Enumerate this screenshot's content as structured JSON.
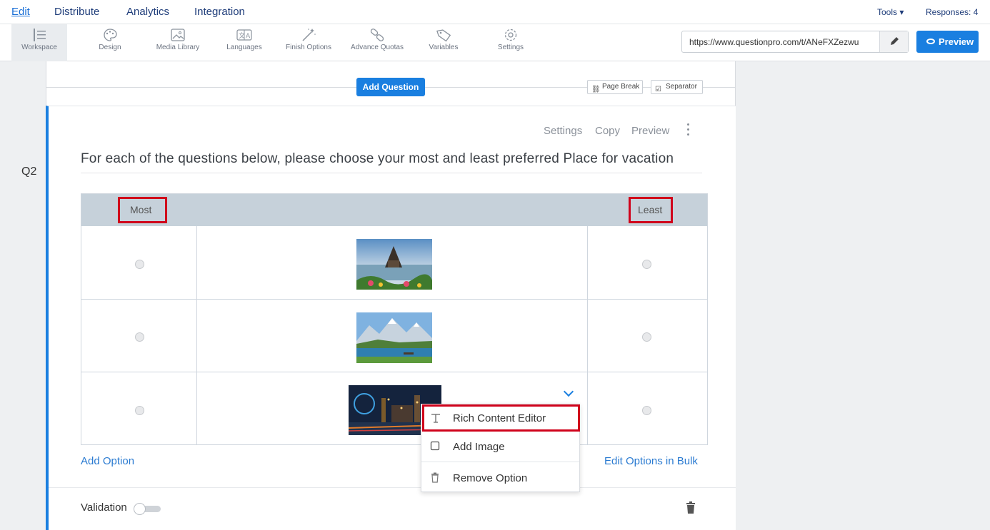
{
  "nav": {
    "items": [
      "Edit",
      "Distribute",
      "Analytics",
      "Integration"
    ],
    "tools": "Tools ▾",
    "responses": "Responses: 4"
  },
  "toolbar": {
    "items": [
      {
        "label": "Workspace",
        "icon": "list-icon"
      },
      {
        "label": "Design",
        "icon": "palette-icon"
      },
      {
        "label": "Media Library",
        "icon": "image-icon"
      },
      {
        "label": "Languages",
        "icon": "translate-icon"
      },
      {
        "label": "Finish Options",
        "icon": "magic-wand-icon"
      },
      {
        "label": "Advance Quotas",
        "icon": "link-icon"
      },
      {
        "label": "Variables",
        "icon": "tag-icon"
      },
      {
        "label": "Settings",
        "icon": "gear-icon"
      }
    ],
    "url": "https://www.questionpro.com/t/ANeFXZezwu",
    "preview_label": "Preview"
  },
  "page_controls": {
    "add_question": "Add Question",
    "page_break": "Page Break",
    "separator": "Separator"
  },
  "question": {
    "number": "Q2",
    "actions": [
      "Settings",
      "Copy",
      "Preview"
    ],
    "text": "For each of the questions below, please choose your most and least preferred Place for vacation",
    "col_most": "Most",
    "col_least": "Least",
    "add_option": "Add Option",
    "edit_bulk": "Edit Options in Bulk",
    "validation": "Validation"
  },
  "menu": {
    "items": [
      "Rich Content Editor",
      "Add Image",
      "Remove Option"
    ]
  },
  "colors": {
    "accent": "#1a7fe0",
    "highlight": "#d0021b",
    "table_header": "#c6d1da"
  }
}
